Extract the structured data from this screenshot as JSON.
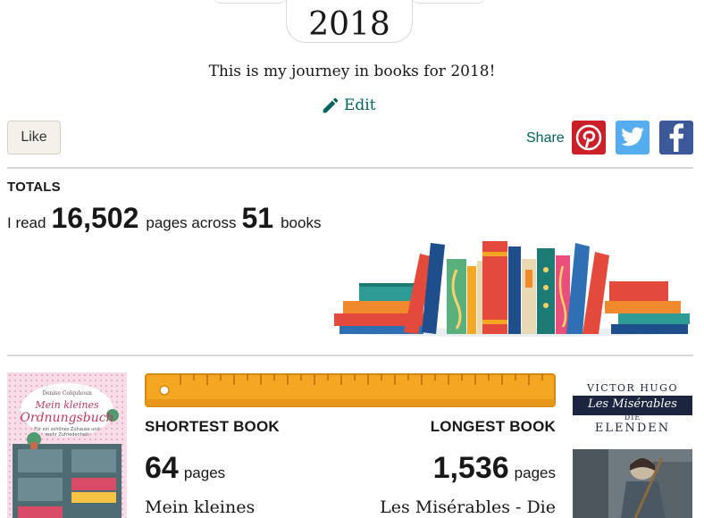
{
  "header": {
    "year": "2018",
    "subtitle": "This is my journey in books for 2018!",
    "edit_label": "Edit"
  },
  "actions": {
    "like_label": "Like",
    "share_label": "Share",
    "share_targets": [
      "pinterest-icon",
      "twitter-icon",
      "facebook-icon"
    ]
  },
  "totals": {
    "heading": "TOTALS",
    "prefix": "I read",
    "pages": "16,502",
    "middle": "pages across",
    "books": "51",
    "suffix": "books"
  },
  "shortest": {
    "heading": "SHORTEST BOOK",
    "pages": "64",
    "unit": "pages",
    "title": "Mein kleines",
    "cover": {
      "author": "Denise Colquhoun",
      "title_line1": "Mein kleines",
      "title_line2": "Ordnungsbuch",
      "tagline1": "Für ein schönes Zuhause und",
      "tagline2": "mehr Zufriedenheit"
    }
  },
  "longest": {
    "heading": "LONGEST BOOK",
    "pages": "1,536",
    "unit": "pages",
    "title": "Les Misérables - Die",
    "cover": {
      "author": "VICTOR HUGO",
      "title_script": "Les Misérables",
      "die": "DIE",
      "elenden": "ELENDEN"
    }
  },
  "colors": {
    "accent": "#00635d",
    "like_bg": "#f4f1ea",
    "pinterest": "#cb2027",
    "twitter": "#55acee",
    "facebook": "#3b5998",
    "ruler": "#f5a623"
  }
}
